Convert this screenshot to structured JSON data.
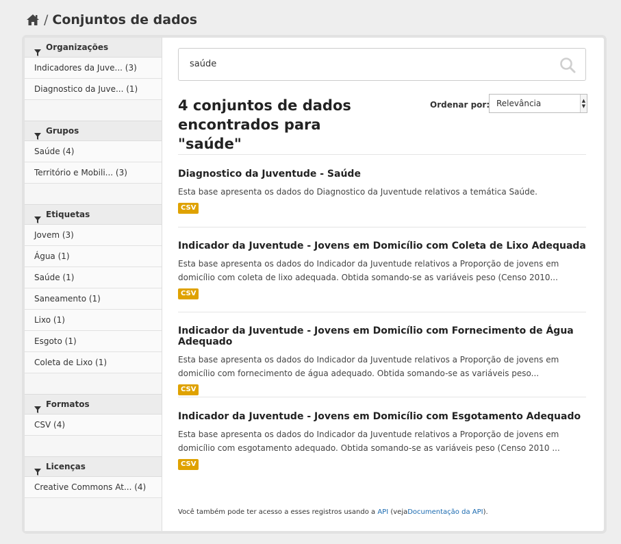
{
  "breadcrumb": {
    "separator": "/",
    "title": "Conjuntos de dados"
  },
  "search": {
    "query": "saúde"
  },
  "results": {
    "count_text": "4 conjuntos de dados encontrados para \"saúde\"",
    "order_label": "Ordenar por:",
    "order_value": "Relevância"
  },
  "facets": [
    {
      "title": "Organizações",
      "items": [
        "Indicadores da Juve... (3)",
        "Diagnostico da Juve... (1)"
      ]
    },
    {
      "title": "Grupos",
      "items": [
        "Saúde (4)",
        "Território e Mobili... (3)"
      ]
    },
    {
      "title": "Etiquetas",
      "items": [
        "Jovem (3)",
        "Água (1)",
        "Saúde (1)",
        "Saneamento (1)",
        "Lixo (1)",
        "Esgoto (1)",
        "Coleta de Lixo (1)"
      ]
    },
    {
      "title": "Formatos",
      "items": [
        "CSV (4)"
      ]
    },
    {
      "title": "Licenças",
      "items": [
        "Creative Commons At... (4)"
      ]
    }
  ],
  "datasets": [
    {
      "title": "Diagnostico da Juventude - Saúde",
      "description": "Esta base apresenta os dados do Diagnostico da Juventude relativos a temática Saúde.",
      "format": "CSV"
    },
    {
      "title": "Indicador da Juventude - Jovens em Domicílio com Coleta de Lixo Adequada",
      "description": "Esta base apresenta os dados do Indicador da Juventude relativos a Proporção de jovens em domicílio com coleta de lixo adequada. Obtida somando-se as variáveis peso (Censo 2010...",
      "format": "CSV"
    },
    {
      "title": "Indicador da Juventude - Jovens em Domicílio com Fornecimento de Água Adequado",
      "description": "Esta base apresenta os dados do Indicador da Juventude relativos a Proporção de jovens em domicílio com fornecimento de água adequado. Obtida somando-se as variáveis peso...",
      "format": "CSV"
    },
    {
      "title": "Indicador da Juventude - Jovens em Domicílio com Esgotamento Adequado",
      "description": "Esta base apresenta os dados do Indicador da Juventude relativos a Proporção de jovens em domicílio com esgotamento adequado. Obtida somando-se as variáveis peso (Censo 2010 ...",
      "format": "CSV"
    }
  ],
  "api_note": {
    "prefix": "Você também pode ter acesso a esses registros usando a",
    "api_link": "API",
    "middle": "(veja",
    "docs_link": "Documentação da API",
    "suffix": ")."
  },
  "colors": {
    "badge": "#dfa200",
    "link": "#1a6ab0"
  }
}
